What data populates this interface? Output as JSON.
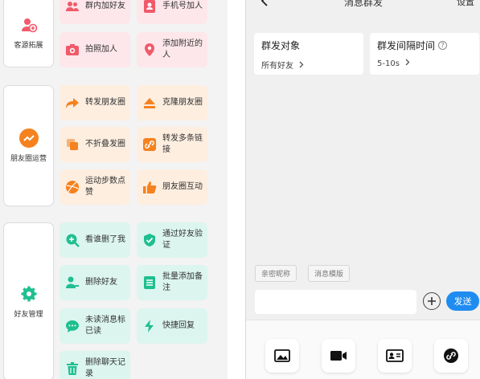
{
  "left_panel": {
    "categories": [
      {
        "label": "客源拓展",
        "icon": "user-add-icon",
        "color": "#f05a6a"
      },
      {
        "label": "朋友圈运营",
        "icon": "trend-icon",
        "color": "#f5821f"
      },
      {
        "label": "好友管理",
        "icon": "gear-icon",
        "color": "#1fbf8f"
      }
    ],
    "tiles": [
      {
        "label": "群内加好友",
        "icon": "group-icon"
      },
      {
        "label": "手机号加人",
        "icon": "contact-card-icon"
      },
      {
        "label": "拍照加人",
        "icon": "camera-icon"
      },
      {
        "label": "添加附近的人",
        "icon": "location-icon"
      },
      {
        "label": "转发朋友圈",
        "icon": "forward-icon"
      },
      {
        "label": "克隆朋友圈",
        "icon": "eject-icon"
      },
      {
        "label": "不折叠发圈",
        "icon": "copy-icon"
      },
      {
        "label": "转发多条链接",
        "icon": "link-icon"
      },
      {
        "label": "运动步数点赞",
        "icon": "ball-icon"
      },
      {
        "label": "朋友圈互动",
        "icon": "thumbs-up-icon"
      },
      {
        "label": "看谁删了我",
        "icon": "search-plus-icon"
      },
      {
        "label": "通过好友验证",
        "icon": "shield-check-icon"
      },
      {
        "label": "删除好友",
        "icon": "user-minus-icon"
      },
      {
        "label": "批量添加备注",
        "icon": "list-icon"
      },
      {
        "label": "未读消息标已读",
        "icon": "chat-icon"
      },
      {
        "label": "快捷回复",
        "icon": "lightning-icon"
      },
      {
        "label": "删除聊天记录",
        "icon": "trash-icon"
      }
    ]
  },
  "right_panel": {
    "back_icon": "chevron-left-icon",
    "title": "消息群发",
    "settings_label": "设置",
    "target_card": {
      "title": "群发对象",
      "value": "所有好友"
    },
    "interval_card": {
      "title": "群发间隔时间",
      "value": "5-10s"
    },
    "chips": [
      "亲密昵称",
      "消息模版"
    ],
    "input_placeholder": "",
    "send_label": "发送",
    "bottom_tools": [
      "image-icon",
      "video-icon",
      "contact-card-icon",
      "link-icon"
    ]
  },
  "colors": {
    "accent_blue": "#1e8cf0",
    "red_tile": "#fde7ea",
    "orange_tile": "#fdeee0",
    "green_tile": "#dcf5ef",
    "red_icon": "#f05a6a",
    "orange_icon": "#f5821f",
    "green_icon": "#1fbf8f"
  }
}
